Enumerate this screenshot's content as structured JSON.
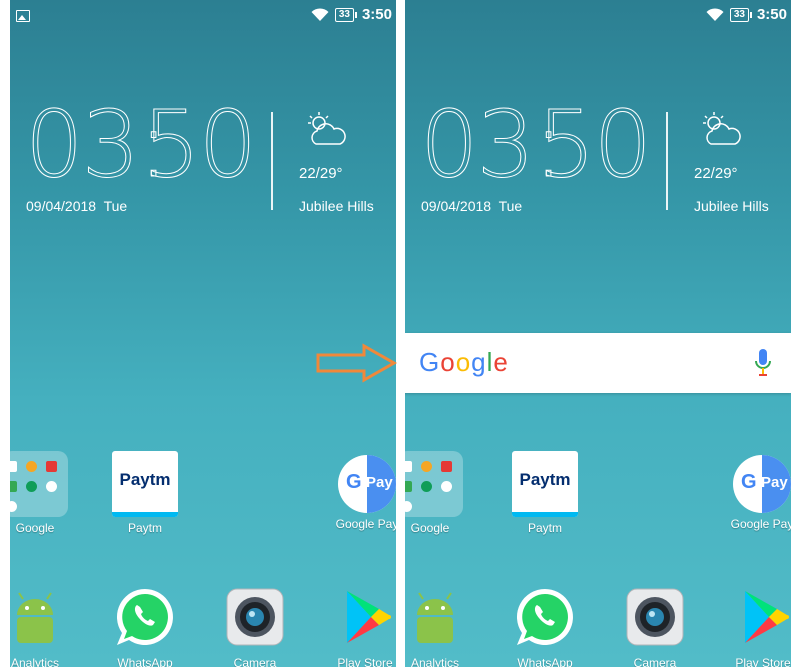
{
  "status": {
    "battery": "33",
    "time": "3:50"
  },
  "clock": {
    "hours": "03",
    "minutes": "50",
    "date": "09/04/2018  Tue"
  },
  "weather": {
    "temp": "22/29°",
    "location": "Jubilee Hills"
  },
  "search": {
    "logo": "Google"
  },
  "apps": [
    {
      "label": "Google"
    },
    {
      "label": "Paytm"
    },
    {
      "label": "Google Pay"
    }
  ],
  "dock": [
    {
      "label": "Analytics"
    },
    {
      "label": "WhatsApp"
    },
    {
      "label": "Camera"
    },
    {
      "label": "Play Store"
    }
  ],
  "paytm": {
    "logo": "Paytm"
  },
  "gpay": {
    "g": "G",
    "pay": "Pay"
  },
  "colors": {
    "accent_arrow": "#f0883a",
    "screen_top": "#2c7f92",
    "screen_bottom": "#52bcc8"
  }
}
